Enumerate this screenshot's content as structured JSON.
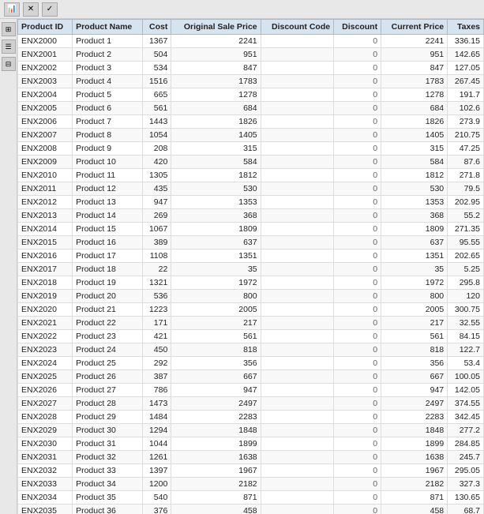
{
  "toolbar": {
    "buttons": [
      {
        "label": "📊",
        "name": "chart-icon"
      },
      {
        "label": "✕",
        "name": "close-icon"
      },
      {
        "label": "✓",
        "name": "check-icon"
      }
    ],
    "sidebar_icons": [
      {
        "label": "⊞",
        "name": "grid-icon"
      },
      {
        "label": "☰",
        "name": "list-icon"
      },
      {
        "label": "⊟",
        "name": "detail-icon"
      }
    ]
  },
  "table": {
    "columns": [
      "Product ID",
      "Product Name",
      "Cost",
      "Original Sale Price",
      "Discount Code",
      "Discount",
      "Current Price",
      "Taxes"
    ],
    "rows": [
      [
        "ENX2000",
        "Product 1",
        "1367",
        "2241",
        "",
        "0",
        "2241",
        "336.15"
      ],
      [
        "ENX2001",
        "Product 2",
        "504",
        "951",
        "",
        "0",
        "951",
        "142.65"
      ],
      [
        "ENX2002",
        "Product 3",
        "534",
        "847",
        "",
        "0",
        "847",
        "127.05"
      ],
      [
        "ENX2003",
        "Product 4",
        "1516",
        "1783",
        "",
        "0",
        "1783",
        "267.45"
      ],
      [
        "ENX2004",
        "Product 5",
        "665",
        "1278",
        "",
        "0",
        "1278",
        "191.7"
      ],
      [
        "ENX2005",
        "Product 6",
        "561",
        "684",
        "",
        "0",
        "684",
        "102.6"
      ],
      [
        "ENX2006",
        "Product 7",
        "1443",
        "1826",
        "",
        "0",
        "1826",
        "273.9"
      ],
      [
        "ENX2007",
        "Product 8",
        "1054",
        "1405",
        "",
        "0",
        "1405",
        "210.75"
      ],
      [
        "ENX2008",
        "Product 9",
        "208",
        "315",
        "",
        "0",
        "315",
        "47.25"
      ],
      [
        "ENX2009",
        "Product 10",
        "420",
        "584",
        "",
        "0",
        "584",
        "87.6"
      ],
      [
        "ENX2010",
        "Product 11",
        "1305",
        "1812",
        "",
        "0",
        "1812",
        "271.8"
      ],
      [
        "ENX2011",
        "Product 12",
        "435",
        "530",
        "",
        "0",
        "530",
        "79.5"
      ],
      [
        "ENX2012",
        "Product 13",
        "947",
        "1353",
        "",
        "0",
        "1353",
        "202.95"
      ],
      [
        "ENX2013",
        "Product 14",
        "269",
        "368",
        "",
        "0",
        "368",
        "55.2"
      ],
      [
        "ENX2014",
        "Product 15",
        "1067",
        "1809",
        "",
        "0",
        "1809",
        "271.35"
      ],
      [
        "ENX2015",
        "Product 16",
        "389",
        "637",
        "",
        "0",
        "637",
        "95.55"
      ],
      [
        "ENX2016",
        "Product 17",
        "1108",
        "1351",
        "",
        "0",
        "1351",
        "202.65"
      ],
      [
        "ENX2017",
        "Product 18",
        "22",
        "35",
        "",
        "0",
        "35",
        "5.25"
      ],
      [
        "ENX2018",
        "Product 19",
        "1321",
        "1972",
        "",
        "0",
        "1972",
        "295.8"
      ],
      [
        "ENX2019",
        "Product 20",
        "536",
        "800",
        "",
        "0",
        "800",
        "120"
      ],
      [
        "ENX2020",
        "Product 21",
        "1223",
        "2005",
        "",
        "0",
        "2005",
        "300.75"
      ],
      [
        "ENX2021",
        "Product 22",
        "171",
        "217",
        "",
        "0",
        "217",
        "32.55"
      ],
      [
        "ENX2022",
        "Product 23",
        "421",
        "561",
        "",
        "0",
        "561",
        "84.15"
      ],
      [
        "ENX2023",
        "Product 24",
        "450",
        "818",
        "",
        "0",
        "818",
        "122.7"
      ],
      [
        "ENX2024",
        "Product 25",
        "292",
        "356",
        "",
        "0",
        "356",
        "53.4"
      ],
      [
        "ENX2025",
        "Product 26",
        "387",
        "667",
        "",
        "0",
        "667",
        "100.05"
      ],
      [
        "ENX2026",
        "Product 27",
        "786",
        "947",
        "",
        "0",
        "947",
        "142.05"
      ],
      [
        "ENX2027",
        "Product 28",
        "1473",
        "2497",
        "",
        "0",
        "2497",
        "374.55"
      ],
      [
        "ENX2028",
        "Product 29",
        "1484",
        "2283",
        "",
        "0",
        "2283",
        "342.45"
      ],
      [
        "ENX2029",
        "Product 30",
        "1294",
        "1848",
        "",
        "0",
        "1848",
        "277.2"
      ],
      [
        "ENX2030",
        "Product 31",
        "1044",
        "1899",
        "",
        "0",
        "1899",
        "284.85"
      ],
      [
        "ENX2031",
        "Product 32",
        "1261",
        "1638",
        "",
        "0",
        "1638",
        "245.7"
      ],
      [
        "ENX2032",
        "Product 33",
        "1397",
        "1967",
        "",
        "0",
        "1967",
        "295.05"
      ],
      [
        "ENX2033",
        "Product 34",
        "1200",
        "2182",
        "",
        "0",
        "2182",
        "327.3"
      ],
      [
        "ENX2034",
        "Product 35",
        "540",
        "871",
        "",
        "0",
        "871",
        "130.65"
      ],
      [
        "ENX2035",
        "Product 36",
        "376",
        "458",
        "",
        "0",
        "458",
        "68.7"
      ]
    ]
  }
}
